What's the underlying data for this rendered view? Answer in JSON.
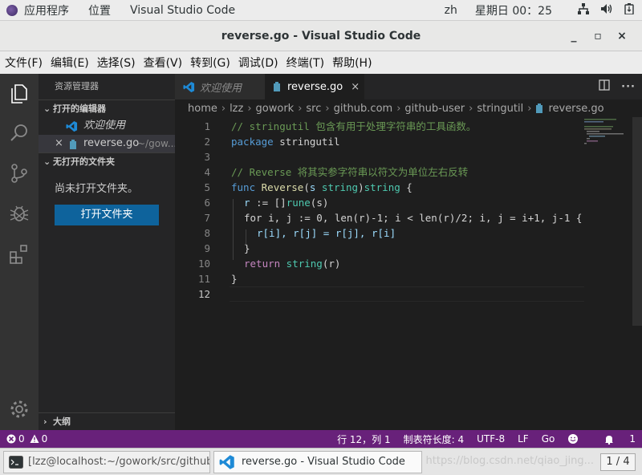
{
  "topbar": {
    "apps_label": "应用程序",
    "places_label": "位置",
    "active_app": "Visual Studio Code",
    "input_method": "zh",
    "clock": "星期日 00：25"
  },
  "window": {
    "title": "reverse.go - Visual Studio Code",
    "minimize": "_",
    "maximize": "▫",
    "close": "×"
  },
  "menu": [
    "文件(F)",
    "编辑(E)",
    "选择(S)",
    "查看(V)",
    "转到(G)",
    "调试(D)",
    "终端(T)",
    "帮助(H)"
  ],
  "sidebar": {
    "title": "资源管理器",
    "open_editors_label": "打开的编辑器",
    "open_editors": [
      {
        "label": "欢迎使用",
        "detail": ""
      },
      {
        "label": "reverse.go",
        "detail": "~/gow..."
      }
    ],
    "no_folder_section": "无打开的文件夹",
    "no_folder_text": "尚未打开文件夹。",
    "open_folder_button": "打开文件夹",
    "outline_label": "大纲"
  },
  "tabs": [
    {
      "label": "欢迎使用",
      "active": false
    },
    {
      "label": "reverse.go",
      "active": true,
      "close": "×"
    }
  ],
  "breadcrumb": [
    "home",
    "lzz",
    "gowork",
    "src",
    "github.com",
    "github-user",
    "stringutil",
    "reverse.go"
  ],
  "editor": {
    "line_numbers": [
      "1",
      "2",
      "3",
      "4",
      "5",
      "6",
      "7",
      "8",
      "9",
      "10",
      "11",
      "12"
    ],
    "lines": {
      "l1": "// stringutil 包含有用于处理字符串的工具函数。",
      "l2_kw": "package",
      "l2_rest": " stringutil",
      "l4": "// Reverse 将其实参字符串以符文为单位左右反转",
      "l5_func": "func",
      "l5_name": "Reverse",
      "l5_open": "(",
      "l5_param": "s",
      "l5_ptype": "string",
      "l5_close": ")",
      "l5_rtype": "string",
      "l5_brace": " {",
      "l6_var": "r",
      "l6_op": " := []",
      "l6_type": "rune",
      "l6_arg": "(s)",
      "l7": "for i, j := 0, len(r)-1; i < len(r)/2; i, j = i+1, j-1 {",
      "l8": "r[i], r[j] = r[j], r[i]",
      "l9": "}",
      "l10_kw": "return",
      "l10_fn": " string",
      "l10_arg": "(r)",
      "l11": "}"
    }
  },
  "status": {
    "errors": "0",
    "warnings": "0",
    "position": "行 12，列 1",
    "tab_size": "制表符长度: 4",
    "encoding": "UTF-8",
    "eol": "LF",
    "language": "Go",
    "notifications": "1"
  },
  "taskbar": {
    "terminal_task": "[lzz@localhost:~/gowork/src/github-...",
    "vscode_task": "reverse.go - Visual Studio Code",
    "watermark": "https://blog.csdn.net/qiao_jing...",
    "pager": "1 / 4"
  },
  "colors": {
    "statusbar": "#68217a",
    "activitybar": "#333333",
    "sidebar": "#252526",
    "editor": "#1e1e1e",
    "button": "#0e639c"
  }
}
